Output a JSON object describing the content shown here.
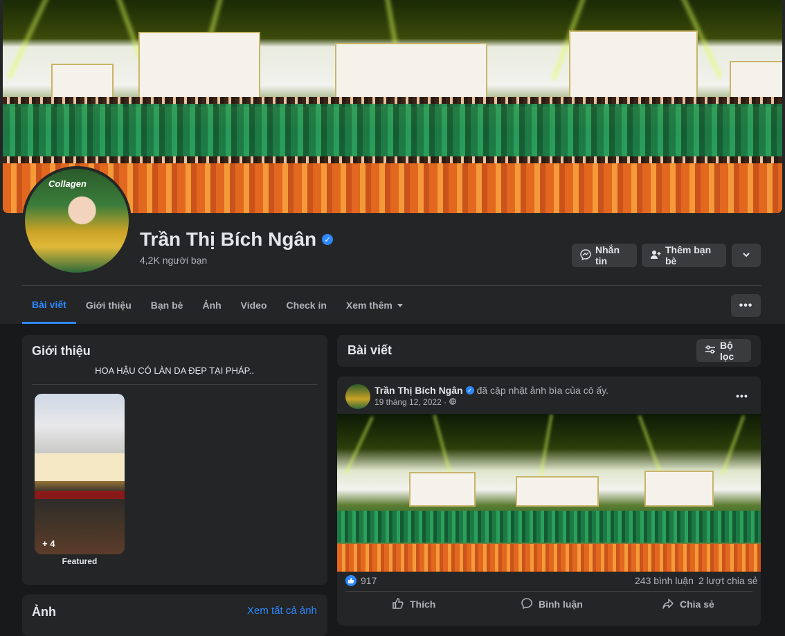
{
  "profile": {
    "name": "Trần Thị Bích Ngân",
    "friends": "4,2K người bạn",
    "avatar_brand": "Collagen"
  },
  "actions": {
    "message": "Nhắn tin",
    "add_friend": "Thêm bạn bè"
  },
  "tabs": [
    {
      "label": "Bài viết",
      "active": true
    },
    {
      "label": "Giới thiệu"
    },
    {
      "label": "Bạn bè"
    },
    {
      "label": "Ảnh"
    },
    {
      "label": "Video"
    },
    {
      "label": "Check in"
    },
    {
      "label": "Xem thêm"
    }
  ],
  "intro": {
    "title": "Giới thiệu",
    "bio": "HOA HẬU CÓ LÀN DA ĐẸP TẠI PHÁP..",
    "featured_count": "+ 4",
    "featured_label": "Featured"
  },
  "photos": {
    "title": "Ảnh",
    "see_all": "Xem tất cả ảnh"
  },
  "posts": {
    "title": "Bài viết",
    "filter": "Bộ lọc"
  },
  "post": {
    "author": "Trần Thị Bích Ngân",
    "action_text": "đã cập nhật ảnh bìa của cô ấy.",
    "date": "19 tháng 12, 2022 ·",
    "reactions": "917",
    "comments": "243 bình luận",
    "shares": "2 lượt chia sẻ",
    "like": "Thích",
    "comment": "Bình luận",
    "share": "Chia sẻ"
  },
  "colors": {
    "accent": "#2d88ff",
    "background": "#18191a",
    "card": "#242526"
  }
}
